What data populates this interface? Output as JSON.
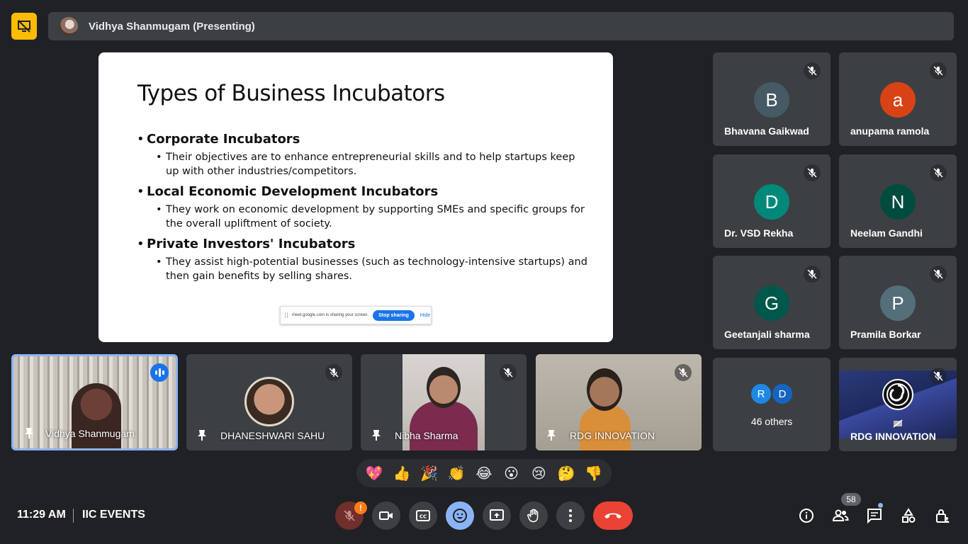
{
  "header": {
    "title": "Vidhya Shanmugam (Presenting)"
  },
  "slide": {
    "title": "Types of Business Incubators",
    "items": [
      {
        "heading": "Corporate Incubators",
        "text": "Their objectives are to enhance entrepreneurial skills and to help startups keep up with other industries/competitors."
      },
      {
        "heading": "Local Economic Development Incubators",
        "text": "They work on economic development by supporting SMEs and specific groups for the overall upliftment of society."
      },
      {
        "heading": "Private Investors' Incubators",
        "text": "They assist high-potential businesses (such as technology-intensive startups) and then gain benefits by selling shares."
      }
    ],
    "share_bar": {
      "message": "meet.google.com is sharing your screen.",
      "stop_label": "Stop sharing",
      "hide_label": "Hide"
    }
  },
  "participants": [
    {
      "name": "Bhavana Gaikwad",
      "initial": "B",
      "color": "#455a64"
    },
    {
      "name": "anupama ramola",
      "initial": "a",
      "color": "#d84315"
    },
    {
      "name": "Dr. VSD Rekha",
      "initial": "D",
      "color": "#00897b"
    },
    {
      "name": "Neelam Gandhi",
      "initial": "N",
      "color": "#004d40"
    },
    {
      "name": "Geetanjali sharma",
      "initial": "G",
      "color": "#00574b"
    },
    {
      "name": "Pramila Borkar",
      "initial": "P",
      "color": "#546e7a"
    }
  ],
  "others": {
    "label": "46 others",
    "initials": [
      "R",
      "D"
    ],
    "colors": [
      "#1e88e5",
      "#1565c0"
    ]
  },
  "rdg_tile": {
    "name": "RDG INNOVATION"
  },
  "video_tiles": [
    {
      "name": "Vidhya Shanmugam"
    },
    {
      "name": "DHANESHWARI SAHU"
    },
    {
      "name": "Nibha Sharma"
    },
    {
      "name": "RDG INNOVATION"
    }
  ],
  "reactions": [
    "💖",
    "👍",
    "🎉",
    "👏",
    "😂",
    "😮",
    "😢",
    "🤔",
    "👎"
  ],
  "footer": {
    "time": "11:29 AM",
    "meeting_name": "IIC EVENTS",
    "mic_warning": "!",
    "participants_count": "58"
  },
  "colors": {
    "background": "#202124",
    "tile": "#3c4043",
    "accent": "#8ab4f8",
    "hangup": "#ea4335"
  }
}
